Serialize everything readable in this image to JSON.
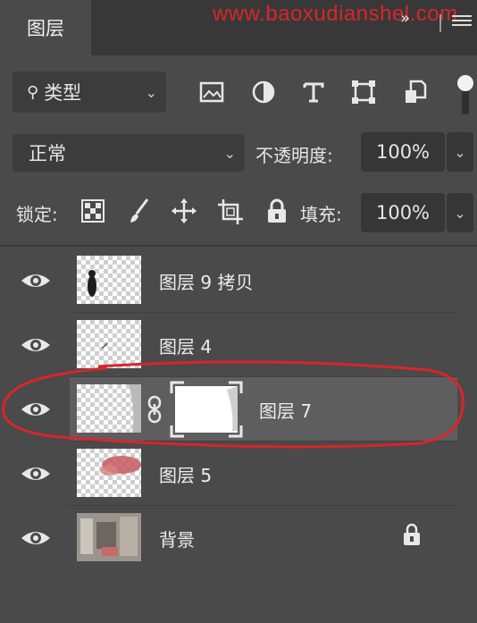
{
  "panel": {
    "tab_label": "图层",
    "watermark": "www.baoxudianshel.com",
    "menu_glyph": "»"
  },
  "filter": {
    "kind_label": "类型",
    "icons": [
      "image-filter-icon",
      "adjustment-filter-icon",
      "type-filter-icon",
      "shape-filter-icon",
      "smart-object-filter-icon"
    ]
  },
  "blend": {
    "mode": "正常",
    "opacity_label": "不透明度:",
    "opacity_value": "100%"
  },
  "lock": {
    "label": "锁定:",
    "icons": [
      "lock-transparent-pixels-icon",
      "lock-image-pixels-icon",
      "lock-position-icon",
      "lock-artboard-icon",
      "lock-all-icon"
    ],
    "fill_label": "填充:",
    "fill_value": "100%"
  },
  "layers": [
    {
      "name": "图层 9 拷贝",
      "visible": true,
      "selected": false,
      "has_mask": false,
      "locked": false
    },
    {
      "name": "图层 4",
      "visible": true,
      "selected": false,
      "has_mask": false,
      "locked": false
    },
    {
      "name": "图层 7",
      "visible": true,
      "selected": true,
      "has_mask": true,
      "locked": false
    },
    {
      "name": "图层 5",
      "visible": true,
      "selected": false,
      "has_mask": false,
      "locked": false
    },
    {
      "name": "背景",
      "visible": true,
      "selected": false,
      "has_mask": false,
      "locked": true
    }
  ],
  "annotation": {
    "color": "#d8262a"
  }
}
